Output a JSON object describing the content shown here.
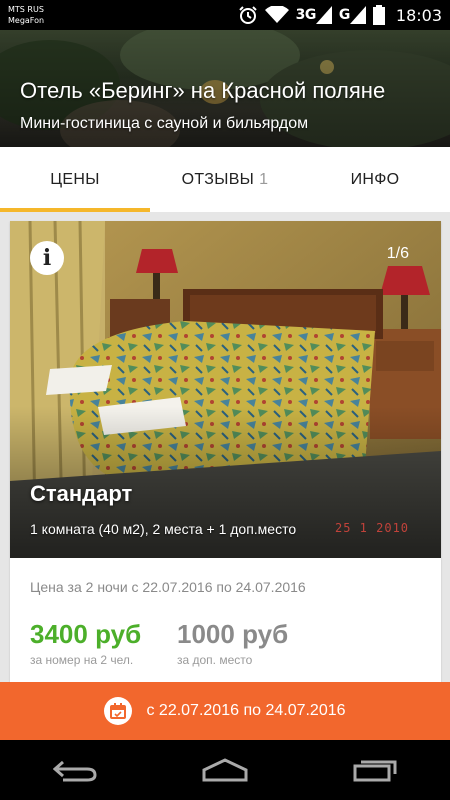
{
  "status_bar": {
    "carrier_line1": "MTS RUS",
    "carrier_line2": "MegaFon",
    "network1": "3G",
    "network2": "G",
    "time": "18:03",
    "icons": [
      "alarm-icon",
      "wifi-icon",
      "signal-icon",
      "signal-icon",
      "battery-icon"
    ]
  },
  "header": {
    "title": "Отель «Беринг» на Красной поляне",
    "subtitle": "Мини-гостиница с сауной и бильярдом"
  },
  "tabs": [
    {
      "label": "ЦЕНЫ",
      "count": "",
      "active": true
    },
    {
      "label": "ОТЗЫВЫ",
      "count": "1",
      "active": false
    },
    {
      "label": "ИНФО",
      "count": "",
      "active": false
    }
  ],
  "room": {
    "photo_counter": "1/6",
    "name": "Стандарт",
    "details": "1 комната (40 м2),  2 места + 1 доп.место",
    "photo_date_stamp": "25  1 2010",
    "price_caption": "Цена за 2 ночи с 22.07.2016 по 24.07.2016",
    "price_main": "3400 руб",
    "price_main_note": "за номер на 2 чел.",
    "price_extra": "1000 руб",
    "price_extra_note": "за доп. место"
  },
  "date_bar": {
    "text": "с 22.07.2016 по 24.07.2016",
    "icon": "calendar-icon"
  },
  "nav": {
    "icons": [
      "back-icon",
      "home-icon",
      "recents-icon"
    ]
  },
  "colors": {
    "accent_tab": "#f5b72a",
    "price_green": "#4caf2a",
    "date_bar_orange": "#f2672d"
  }
}
